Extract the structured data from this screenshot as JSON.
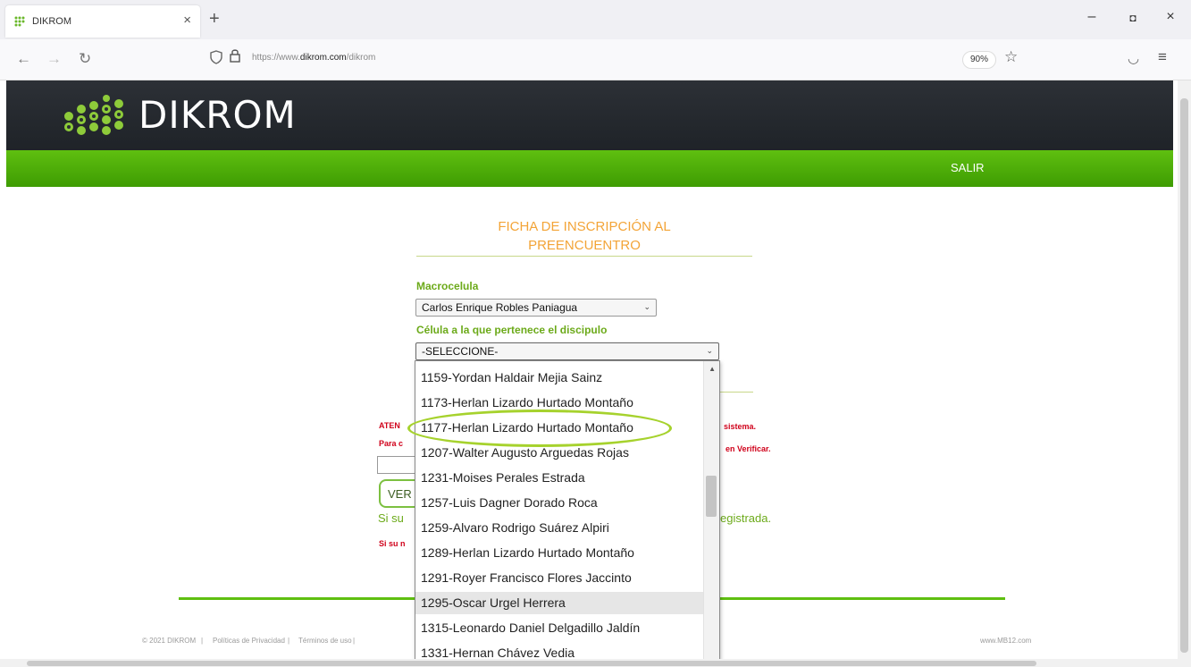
{
  "browser": {
    "tab_title": "DIKROM",
    "new_tab": "+",
    "tab_close": "×",
    "window": {
      "minimize": "–",
      "restore": "◘",
      "close": "×"
    },
    "nav": {
      "back": "←",
      "forward": "→",
      "reload": "↻"
    },
    "url_prefix": "https://www.",
    "url_domain": "dikrom.com",
    "url_suffix": "/dikrom",
    "zoom": "90%",
    "star": "☆",
    "pocket": "◡",
    "menu": "≡"
  },
  "site": {
    "logo_text": "DIKROM",
    "logout_label": "SALIR"
  },
  "form": {
    "title_line1": "FICHA DE INSCRIPCIÓN AL",
    "title_line2": "PREENCUENTRO",
    "macro_label": "Macrocelula",
    "macro_value": "Carlos Enrique Robles Paniagua",
    "cell_label": "Célula a la que pertenece el discipulo",
    "cell_value": "-SELECCIONE-",
    "warn_left1": "ATEN",
    "warn_right1": "sistema.",
    "warn_left2": "Para c",
    "warn_right2": "en Verificar.",
    "verify_btn": "VER",
    "green_left": "Si su",
    "green_right": "egistrada.",
    "red_left": "Si su n"
  },
  "dropdown": {
    "options": [
      "1159-Yordan Haldair Mejia Sainz",
      "1173-Herlan Lizardo Hurtado Montaño",
      "1177-Herlan Lizardo Hurtado Montaño",
      "1207-Walter Augusto Arguedas Rojas",
      "1231-Moises Perales Estrada",
      "1257-Luis Dagner Dorado Roca",
      "1259-Alvaro Rodrigo Suárez Alpiri",
      "1289-Herlan Lizardo Hurtado Montaño",
      "1291-Royer Francisco Flores Jaccinto",
      "1295-Oscar Urgel Herrera",
      "1315-Leonardo Daniel Delgadillo Jaldín",
      "1331-Hernan Chávez Vedia"
    ],
    "hovered": "1295-Oscar Urgel Herrera",
    "circled": "1177-Herlan Lizardo Hurtado Montaño"
  },
  "footer": {
    "copyright": "© 2021 DIKROM",
    "privacy": "Políticas de Privacidad",
    "terms": "Términos de uso",
    "site_link": "www.MB12.com"
  },
  "colors": {
    "header_dark": "#23272c",
    "green": "#4aa80a",
    "title_orange": "#f3a437",
    "label_green": "#6caa1a",
    "warning_red": "#d0021b",
    "highlight_ring": "#a6d22d"
  }
}
